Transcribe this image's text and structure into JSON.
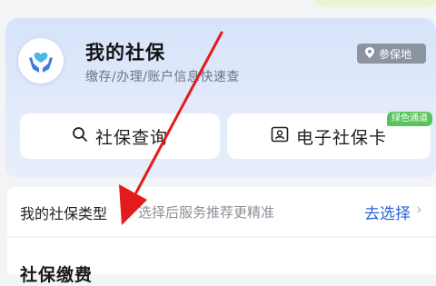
{
  "header": {
    "title": "我的社保",
    "subtitle": "缴存/办理/账户信息快速查",
    "location_button": "参保地",
    "logo_icon": "hands-heart-icon"
  },
  "actions": [
    {
      "label": "社保查询",
      "icon": "search-icon"
    },
    {
      "label": "电子社保卡",
      "icon": "id-card-icon",
      "badge": "绿色通道"
    }
  ],
  "type_row": {
    "label": "我的社保类型",
    "hint": "选择后服务推荐更精准",
    "action": "去选择"
  },
  "next_section": {
    "title": "社保缴费"
  },
  "colors": {
    "accent": "#2b63d9",
    "badge_green": "#57c45a",
    "arrow_red": "#e31b1b"
  }
}
